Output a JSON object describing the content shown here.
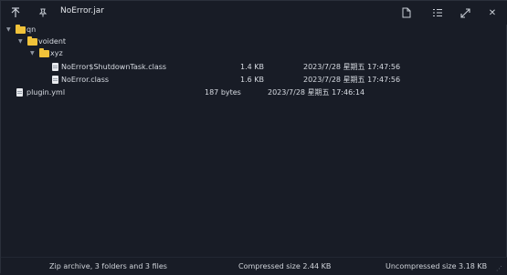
{
  "window": {
    "title": "NoError.jar"
  },
  "toolbar": {
    "up_icon": "arrow-up-icon",
    "pin_icon": "pin-icon",
    "page_icon": "page-icon",
    "list_icon": "list-icon",
    "expand_icon": "expand-icon",
    "close_label": "✕"
  },
  "tree": {
    "qn": "qn",
    "voident": "voident",
    "xyz": "xyz",
    "file1": {
      "name": "NoError$ShutdownTask.class",
      "size": "1.4 KB",
      "date": "2023/7/28 星期五 17:47:56"
    },
    "file2": {
      "name": "NoError.class",
      "size": "1.6 KB",
      "date": "2023/7/28 星期五 17:47:56"
    },
    "file3": {
      "name": "plugin.yml",
      "size": "187 bytes",
      "date": "2023/7/28 星期五 17:46:14"
    }
  },
  "status": {
    "summary": "Zip archive, 3 folders and 3 files",
    "compressed": "Compressed size 2.44 KB",
    "uncompressed": "Uncompressed size 3.18 KB"
  },
  "colors": {
    "background": "#181c26",
    "folder": "#f0c23a"
  }
}
